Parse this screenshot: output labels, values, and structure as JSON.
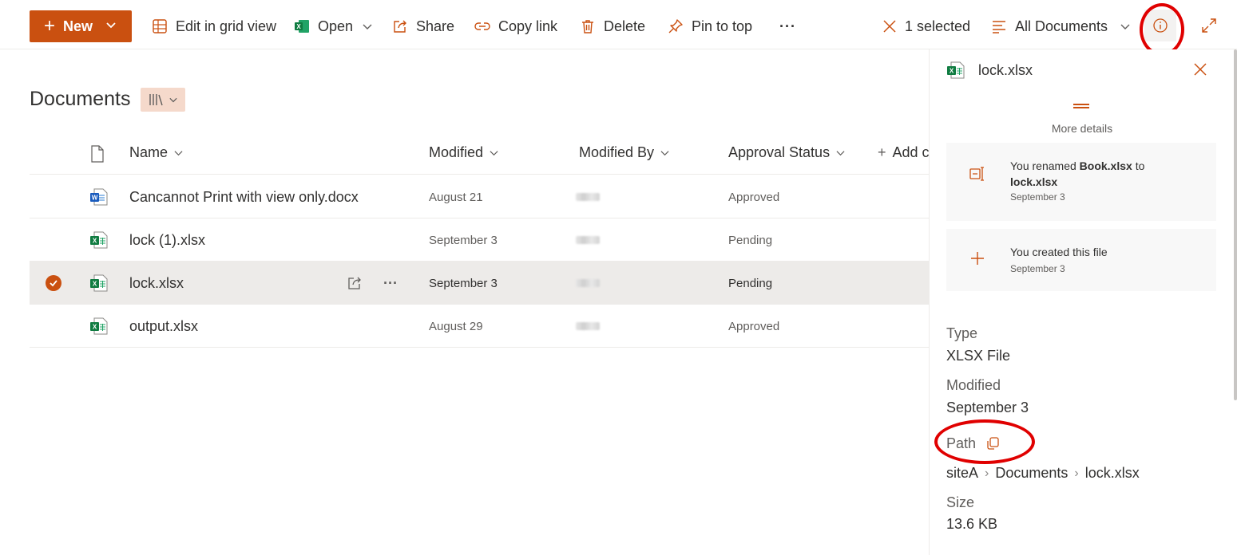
{
  "toolbar": {
    "new_label": "New",
    "edit_grid_label": "Edit in grid view",
    "open_label": "Open",
    "share_label": "Share",
    "copy_link_label": "Copy link",
    "delete_label": "Delete",
    "pin_label": "Pin to top",
    "more_label": "···",
    "selected_label": "1 selected",
    "view_label": "All Documents"
  },
  "page": {
    "title": "Documents"
  },
  "list": {
    "columns": {
      "name": "Name",
      "modified": "Modified",
      "modified_by": "Modified By",
      "approval": "Approval Status",
      "add_column": "Add c"
    },
    "rows": [
      {
        "name": "Cancannot Print with view only.docx",
        "type": "word",
        "modified": "August 21",
        "approval": "Approved",
        "selected": false
      },
      {
        "name": "lock (1).xlsx",
        "type": "excel",
        "modified": "September 3",
        "approval": "Pending",
        "selected": false
      },
      {
        "name": "lock.xlsx",
        "type": "excel",
        "modified": "September 3",
        "approval": "Pending",
        "selected": true
      },
      {
        "name": "output.xlsx",
        "type": "excel",
        "modified": "August 29",
        "approval": "Approved",
        "selected": false
      }
    ]
  },
  "details": {
    "file_name": "lock.xlsx",
    "more_details": "More details",
    "activity": [
      {
        "pre": "You renamed ",
        "bold1": "Book.xlsx",
        "mid": " to ",
        "bold2": "lock.xlsx",
        "date": "September 3",
        "icon": "rename-icon"
      },
      {
        "text": "You created this file",
        "date": "September 3",
        "icon": "plus-icon"
      }
    ],
    "type_label": "Type",
    "type_value": "XLSX File",
    "modified_label": "Modified",
    "modified_value": "September 3",
    "path_label": "Path",
    "path": [
      "siteA",
      "Documents",
      "lock.xlsx"
    ],
    "path_sep": "›",
    "size_label": "Size",
    "size_value": "13.6 KB"
  },
  "colors": {
    "accent": "#ca5010",
    "annotation": "#e00000",
    "selected_row": "#edebe9"
  }
}
